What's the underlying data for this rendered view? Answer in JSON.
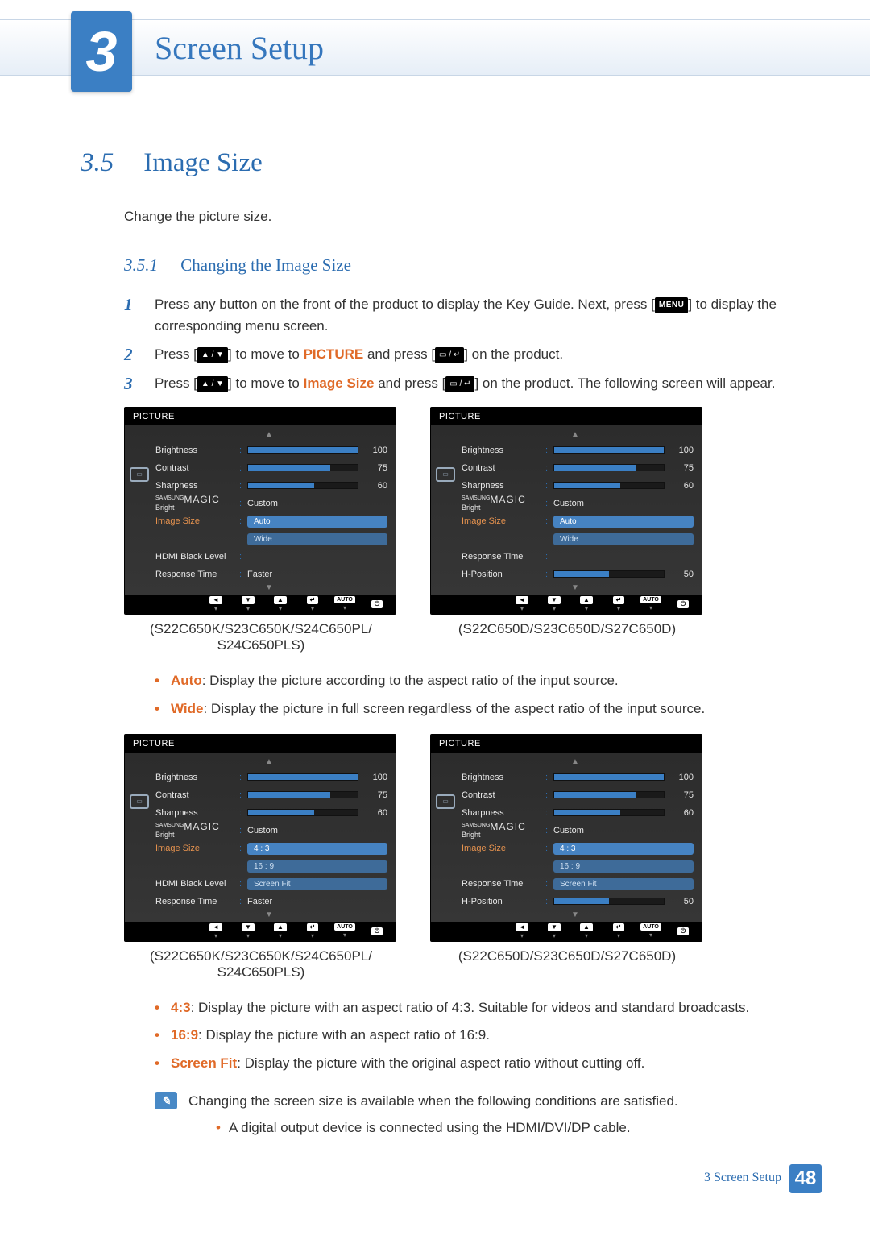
{
  "header": {
    "chapter_number": "3",
    "chapter_title": "Screen Setup"
  },
  "section": {
    "number": "3.5",
    "title": "Image Size",
    "intro": "Change the picture size.",
    "subsection": {
      "number": "3.5.1",
      "title": "Changing the Image Size"
    }
  },
  "steps": {
    "s1_num": "1",
    "s1_a": "Press any button on the front of the product to display the Key Guide. Next, press [",
    "s1_menu": "MENU",
    "s1_b": "] to display the corresponding menu screen.",
    "s2_num": "2",
    "s2_a": "Press [",
    "s2_arrows": "▲ / ▼",
    "s2_b": "] to move to ",
    "s2_kw": "PICTURE",
    "s2_c": " and press [",
    "s2_btn": "▭ / ↵",
    "s2_d": "] on the product.",
    "s3_num": "3",
    "s3_a": "Press [",
    "s3_b": "] to move to ",
    "s3_kw": "Image Size",
    "s3_c": " and press [",
    "s3_d": "] on the product. The following screen will appear."
  },
  "osd_labels": {
    "title": "PICTURE",
    "brightness": "Brightness",
    "contrast": "Contrast",
    "sharpness": "Sharpness",
    "magic_small": "SAMSUNG",
    "magic_big": "MAGIC",
    "magic_tail": " Bright",
    "image_size": "Image Size",
    "hdmi_black": "HDMI Black Level",
    "response": "Response Time",
    "hpos": "H-Position",
    "custom": "Custom",
    "faster": "Faster",
    "auto": "Auto",
    "wide": "Wide",
    "r43": "4 : 3",
    "r169": "16 : 9",
    "screen_fit": "Screen Fit",
    "foot_auto": "AUTO",
    "val100": "100",
    "val75": "75",
    "val60": "60",
    "val50": "50"
  },
  "captions": {
    "group_k": "(S22C650K/S23C650K/S24C650PL/",
    "group_k2": "S24C650PLS)",
    "group_d": "(S22C650D/S23C650D/S27C650D)"
  },
  "desc1": {
    "auto_k": "Auto",
    "auto_t": ": Display the picture according to the aspect ratio of the input source.",
    "wide_k": "Wide",
    "wide_t": ": Display the picture in full screen regardless of the aspect ratio of the input source."
  },
  "desc2": {
    "r43_k": "4:3",
    "r43_t": ": Display the picture with an aspect ratio of 4:3. Suitable for videos and standard broadcasts.",
    "r169_k": "16:9",
    "r169_t": ": Display the picture with an aspect ratio of 16:9.",
    "sf_k": "Screen Fit",
    "sf_t": ": Display the picture with the original aspect ratio without cutting off."
  },
  "note": {
    "line": "Changing the screen size is available when the following conditions are satisfied.",
    "sub1": "A digital output device is connected using the HDMI/DVI/DP cable."
  },
  "chart_data": [
    {
      "type": "table",
      "title": "PICTURE OSD — model group K (top-left)",
      "rows": [
        {
          "label": "Brightness",
          "value": 100,
          "range": [
            0,
            100
          ]
        },
        {
          "label": "Contrast",
          "value": 75,
          "range": [
            0,
            100
          ]
        },
        {
          "label": "Sharpness",
          "value": 60,
          "range": [
            0,
            100
          ]
        },
        {
          "label": "SAMSUNG MAGIC Bright",
          "value": "Custom"
        },
        {
          "label": "Image Size",
          "value": "Auto",
          "options": [
            "Auto",
            "Wide"
          ],
          "highlighted": true
        },
        {
          "label": "HDMI Black Level",
          "value": ""
        },
        {
          "label": "Response Time",
          "value": "Faster"
        }
      ]
    },
    {
      "type": "table",
      "title": "PICTURE OSD — model group D (top-right)",
      "rows": [
        {
          "label": "Brightness",
          "value": 100,
          "range": [
            0,
            100
          ]
        },
        {
          "label": "Contrast",
          "value": 75,
          "range": [
            0,
            100
          ]
        },
        {
          "label": "Sharpness",
          "value": 60,
          "range": [
            0,
            100
          ]
        },
        {
          "label": "SAMSUNG MAGIC Bright",
          "value": "Custom"
        },
        {
          "label": "Image Size",
          "value": "Auto",
          "options": [
            "Auto",
            "Wide"
          ],
          "highlighted": true
        },
        {
          "label": "Response Time",
          "value": ""
        },
        {
          "label": "H-Position",
          "value": 50,
          "range": [
            0,
            100
          ]
        }
      ]
    },
    {
      "type": "table",
      "title": "PICTURE OSD — model group K (bottom-left)",
      "rows": [
        {
          "label": "Brightness",
          "value": 100,
          "range": [
            0,
            100
          ]
        },
        {
          "label": "Contrast",
          "value": 75,
          "range": [
            0,
            100
          ]
        },
        {
          "label": "Sharpness",
          "value": 60,
          "range": [
            0,
            100
          ]
        },
        {
          "label": "SAMSUNG MAGIC Bright",
          "value": "Custom"
        },
        {
          "label": "Image Size",
          "value": "4 : 3",
          "options": [
            "4 : 3",
            "16 : 9",
            "Screen Fit"
          ],
          "highlighted": true
        },
        {
          "label": "HDMI Black Level",
          "value": ""
        },
        {
          "label": "Response Time",
          "value": "Faster"
        }
      ]
    },
    {
      "type": "table",
      "title": "PICTURE OSD — model group D (bottom-right)",
      "rows": [
        {
          "label": "Brightness",
          "value": 100,
          "range": [
            0,
            100
          ]
        },
        {
          "label": "Contrast",
          "value": 75,
          "range": [
            0,
            100
          ]
        },
        {
          "label": "Sharpness",
          "value": 60,
          "range": [
            0,
            100
          ]
        },
        {
          "label": "SAMSUNG MAGIC Bright",
          "value": "Custom"
        },
        {
          "label": "Image Size",
          "value": "4 : 3",
          "options": [
            "4 : 3",
            "16 : 9",
            "Screen Fit"
          ],
          "highlighted": true
        },
        {
          "label": "Response Time",
          "value": ""
        },
        {
          "label": "H-Position",
          "value": 50,
          "range": [
            0,
            100
          ]
        }
      ]
    }
  ],
  "footer": {
    "label": "3 Screen Setup",
    "page": "48"
  }
}
